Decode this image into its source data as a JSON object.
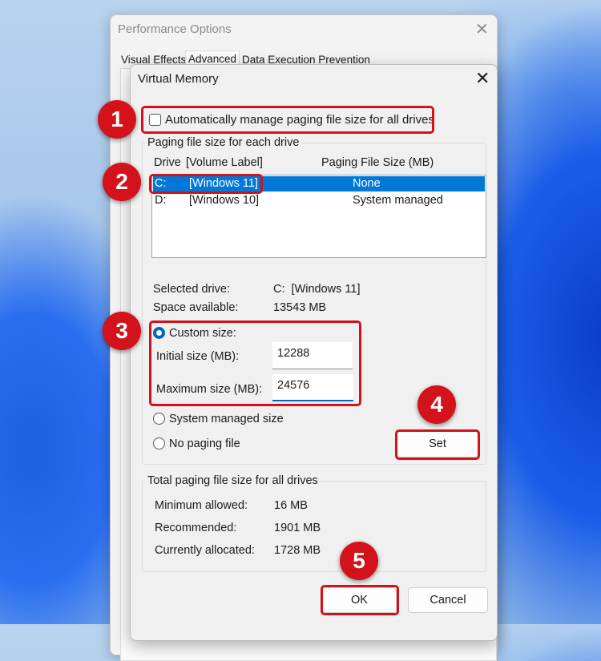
{
  "perf_window": {
    "title": "Performance Options",
    "tabs": [
      "Visual Effects",
      "Advanced",
      "Data Execution Prevention"
    ]
  },
  "dialog": {
    "title": "Virtual Memory",
    "auto_manage_label": "Automatically manage paging file size for all drives",
    "auto_manage_checked": false,
    "group1_title": "Paging file size for each drive",
    "columns": {
      "drive": "Drive",
      "volume": "[Volume Label]",
      "size": "Paging File Size (MB)"
    },
    "drives": [
      {
        "drive": "C:",
        "label": "[Windows 11]",
        "size": "None",
        "selected": true
      },
      {
        "drive": "D:",
        "label": "[Windows 10]",
        "size": "System managed",
        "selected": false
      }
    ],
    "selected_drive_label": "Selected drive:",
    "selected_drive_value": "C:  [Windows 11]",
    "space_label": "Space available:",
    "space_value": "13543 MB",
    "custom_size_label": "Custom size:",
    "initial_label": "Initial size (MB):",
    "initial_value": "12288",
    "max_label": "Maximum size (MB):",
    "max_value": "24576",
    "system_managed_label": "System managed size",
    "no_paging_label": "No paging file",
    "set_label": "Set",
    "group2_title": "Total paging file size for all drives",
    "min_label": "Minimum allowed:",
    "min_value": "16 MB",
    "rec_label": "Recommended:",
    "rec_value": "1901 MB",
    "cur_label": "Currently allocated:",
    "cur_value": "1728 MB",
    "ok_label": "OK",
    "cancel_label": "Cancel",
    "close_icon": "×"
  },
  "badges": [
    "1",
    "2",
    "3",
    "4",
    "5"
  ],
  "colors": {
    "accent": "#0078d7",
    "callout": "#d4121b"
  }
}
